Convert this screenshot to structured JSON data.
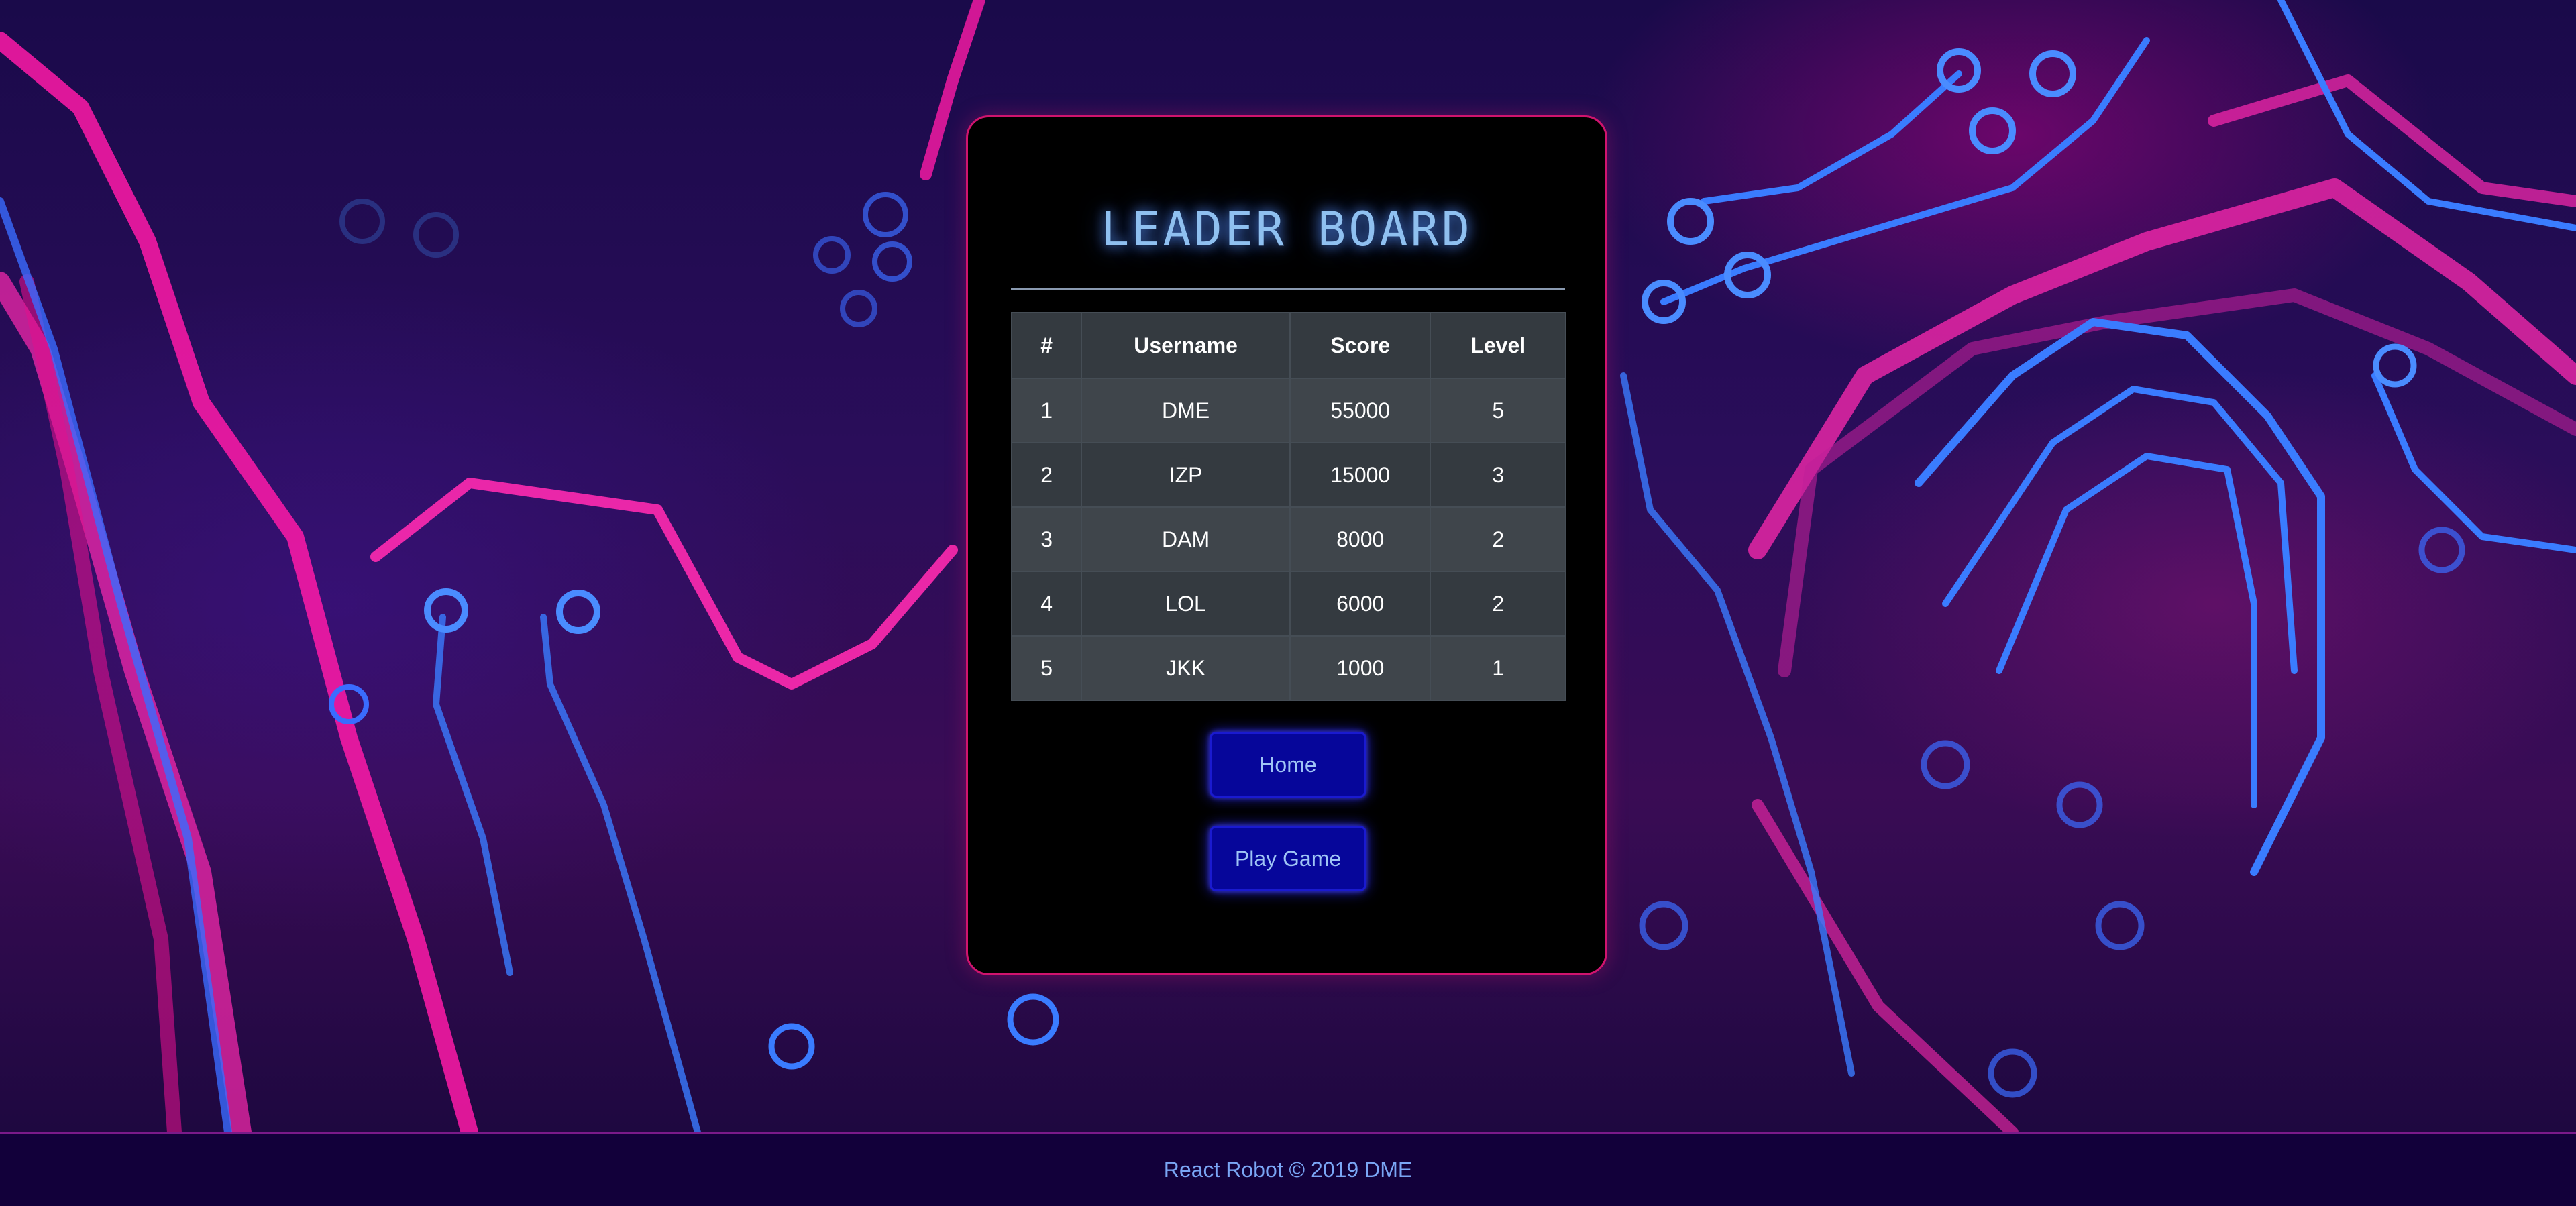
{
  "leaderboard": {
    "title": "LEADER BOARD",
    "columns": [
      "#",
      "Username",
      "Score",
      "Level"
    ],
    "rows": [
      {
        "rank": "1",
        "username": "DME",
        "score": "55000",
        "level": "5"
      },
      {
        "rank": "2",
        "username": "IZP",
        "score": "15000",
        "level": "3"
      },
      {
        "rank": "3",
        "username": "DAM",
        "score": "8000",
        "level": "2"
      },
      {
        "rank": "4",
        "username": "LOL",
        "score": "6000",
        "level": "2"
      },
      {
        "rank": "5",
        "username": "JKK",
        "score": "1000",
        "level": "1"
      }
    ]
  },
  "buttons": {
    "home_label": "Home",
    "play_label": "Play Game"
  },
  "footer": {
    "text": "React Robot © 2019 DME"
  },
  "colors": {
    "card_border": "#d0146e",
    "title_text": "#8fc0f0",
    "button_bg": "#06069a",
    "footer_bg": "#12003a",
    "footer_text": "#7aa6f5"
  }
}
